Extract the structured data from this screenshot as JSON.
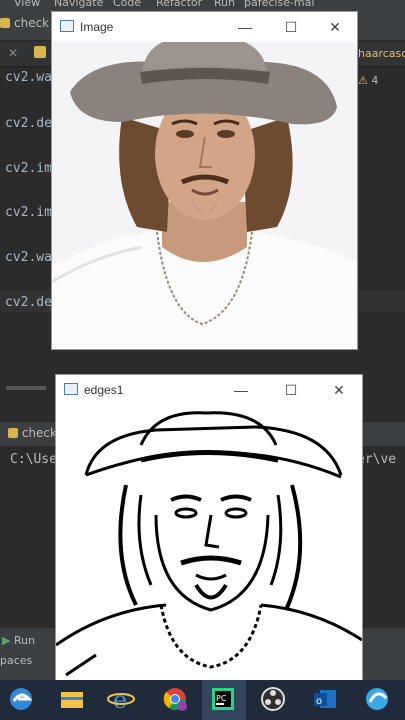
{
  "ide": {
    "menu": [
      "View",
      "Navigate",
      "Code",
      "Refactor",
      "Run",
      "pafecise-mal"
    ],
    "tab_label": "check",
    "right_tab": "haarcasc",
    "warning_count": "4",
    "editor_lines": [
      "cv2.wa",
      "cv2.de",
      "cv2.im",
      "cv2.im",
      "cv2.wa",
      "cv2.de"
    ],
    "run_tab": "check2",
    "console_text": "C:\\Use",
    "console_tail": "er\\ve",
    "run_button": "Run",
    "spaces_label": "paces"
  },
  "windows": [
    {
      "title": "Image",
      "minimize": "—",
      "maximize": "☐",
      "close": "✕"
    },
    {
      "title": "edges1",
      "minimize": "—",
      "maximize": "☐",
      "close": "✕"
    }
  ],
  "taskbar": {
    "apps": [
      "edge-legacy",
      "file-explorer",
      "internet-explorer",
      "chrome-profile",
      "pycharm",
      "obs",
      "outlook",
      "browser"
    ]
  }
}
